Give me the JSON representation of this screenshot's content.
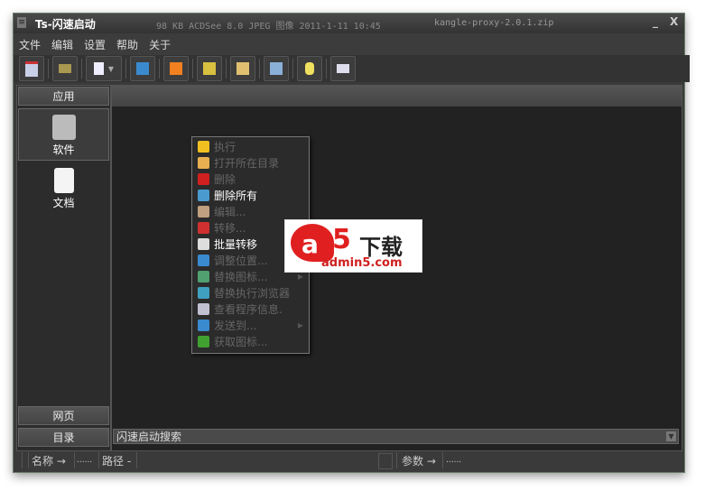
{
  "background": {
    "file_info": "98 KB  ACDSee 8.0 JPEG 图像  2011-1-11 10:45",
    "file_name": "kangle-proxy-2.0.1.zip"
  },
  "window": {
    "title": "Ts-闪速启动",
    "minimize": "_",
    "close": "X"
  },
  "menu": [
    "文件",
    "编辑",
    "设置",
    "帮助",
    "关于"
  ],
  "toolbar": [
    "calendar-icon",
    "folder-icon",
    "new-page-icon",
    "add-file-icon",
    "rss-add-icon",
    "folder-add-icon",
    "note-icon",
    "edit-icon",
    "database-icon",
    "card-icon"
  ],
  "left": {
    "top_category": "应用",
    "items": [
      {
        "label": "软件",
        "icon": "tools-icon"
      },
      {
        "label": "文档",
        "icon": "document-icon"
      }
    ],
    "bottom_categories": [
      "网页",
      "目录"
    ]
  },
  "search": {
    "placeholder": "闪速启动搜索"
  },
  "status": {
    "name_label": "名称 →",
    "name_value": "......",
    "path_label": "路径 -",
    "param_label": "参数 →",
    "param_value": "......"
  },
  "context_menu": [
    {
      "label": "执行",
      "enabled": false,
      "icon": "lightning-icon",
      "color": "#f0c020"
    },
    {
      "label": "打开所在目录",
      "enabled": false,
      "icon": "folder-open-icon",
      "color": "#e8b050"
    },
    {
      "label": "删除",
      "enabled": false,
      "icon": "delete-x-icon",
      "color": "#d02020"
    },
    {
      "label": "删除所有",
      "enabled": true,
      "icon": "delete-all-icon",
      "color": "#4a9ad0"
    },
    {
      "label": "编辑...",
      "enabled": false,
      "icon": "edit-pencil-icon",
      "color": "#c0a080"
    },
    {
      "label": "转移...",
      "enabled": false,
      "icon": "move-icon",
      "color": "#d03030"
    },
    {
      "label": "批量转移",
      "enabled": true,
      "icon": "batch-move-icon",
      "color": "#dddddd"
    },
    {
      "label": "调整位置...",
      "enabled": false,
      "icon": "usb-icon",
      "color": "#3a8ad0"
    },
    {
      "label": "替换图标...",
      "enabled": false,
      "icon": "image-replace-icon",
      "color": "#50a070",
      "submenu": true
    },
    {
      "label": "替换执行浏览器",
      "enabled": false,
      "icon": "browser-refresh-icon",
      "color": "#40a0c0"
    },
    {
      "label": "查看程序信息.",
      "enabled": false,
      "icon": "info-card-icon",
      "color": "#c0c0d0"
    },
    {
      "label": "发送到...",
      "enabled": false,
      "icon": "send-usb-icon",
      "color": "#3a8ad0",
      "submenu": true
    },
    {
      "label": "获取图标...",
      "enabled": false,
      "icon": "get-icon",
      "color": "#40a030"
    }
  ],
  "watermark": {
    "text": "a5下载",
    "url": "admin5.com"
  }
}
